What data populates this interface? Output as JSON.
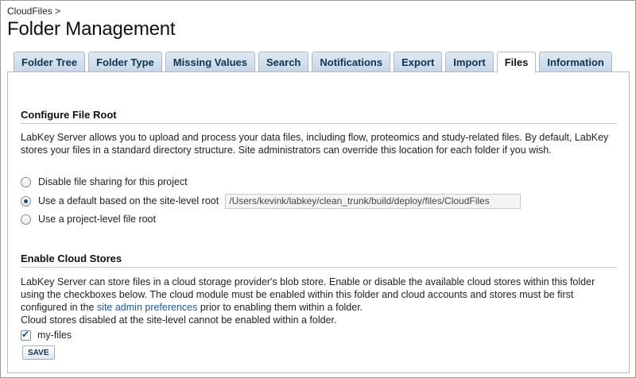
{
  "header": {
    "breadcrumb": "CloudFiles >",
    "title": "Folder Management"
  },
  "tabs": [
    {
      "label": "Folder Tree",
      "active": false
    },
    {
      "label": "Folder Type",
      "active": false
    },
    {
      "label": "Missing Values",
      "active": false
    },
    {
      "label": "Search",
      "active": false
    },
    {
      "label": "Notifications",
      "active": false
    },
    {
      "label": "Export",
      "active": false
    },
    {
      "label": "Import",
      "active": false
    },
    {
      "label": "Files",
      "active": true
    },
    {
      "label": "Information",
      "active": false
    }
  ],
  "file_root": {
    "title": "Configure File Root",
    "description": "LabKey Server allows you to upload and process your data files, including flow, proteomics and study-related files. By default, LabKey stores your files in a standard directory structure. Site administrators can override this location for each folder if you wish.",
    "options": [
      {
        "label": "Disable file sharing for this project",
        "checked": false
      },
      {
        "label": "Use a default based on the site-level root",
        "checked": true
      },
      {
        "label": "Use a project-level file root",
        "checked": false
      }
    ],
    "default_root_value": "/Users/kevink/labkey/clean_trunk/build/deploy/files/CloudFiles"
  },
  "cloud_stores": {
    "title": "Enable Cloud Stores",
    "description_before_link": "LabKey Server can store files in a cloud storage provider's blob store. Enable or disable the available cloud stores within this folder using the checkboxes below. The cloud module must be enabled within this folder and cloud accounts and stores must be first configured in the",
    "link_text": "site admin preferences",
    "description_after_link": "prior to enabling them within a folder.",
    "note": "Cloud stores disabled at the site-level cannot be enabled within a folder.",
    "stores": [
      {
        "label": "my-files",
        "checked": true
      }
    ],
    "save_label": "SAVE"
  },
  "colors": {
    "tab_text": "#11334f",
    "link": "#1e57a4",
    "tab_bg": "#c6d6e7"
  }
}
